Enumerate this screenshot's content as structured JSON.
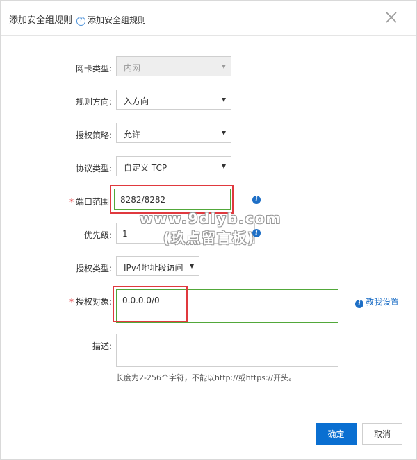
{
  "dialog": {
    "title": "添加安全组规则",
    "help_icon": "?",
    "subtitle": "添加安全组规则",
    "close_icon": "close-icon"
  },
  "form": {
    "nic_type": {
      "label": "网卡类型:",
      "value": "内网"
    },
    "direction": {
      "label": "规则方向:",
      "value": "入方向"
    },
    "policy": {
      "label": "授权策略:",
      "value": "允许"
    },
    "protocol": {
      "label": "协议类型:",
      "value": "自定义 TCP"
    },
    "port_range": {
      "required": "*",
      "label": "端口范围:",
      "value": "8282/8282"
    },
    "priority": {
      "label": "优先级:",
      "value": "1"
    },
    "auth_type": {
      "label": "授权类型:",
      "value": "IPv4地址段访问"
    },
    "auth_object": {
      "required": "*",
      "label": "授权对象:",
      "value": "0.0.0.0/0",
      "help_link": "教我设置"
    },
    "description": {
      "label": "描述:",
      "value": "",
      "hint": "长度为2-256个字符，不能以http://或https://开头。"
    }
  },
  "footer": {
    "confirm": "确定",
    "cancel": "取消"
  },
  "watermark": {
    "line1": "www.9dlyb.com",
    "line2": "(玖点留言板)"
  },
  "colors": {
    "primary": "#0a6fd1",
    "highlight_border": "#e0393e",
    "valid_border": "#52a83a",
    "info": "#1e6fc6"
  }
}
